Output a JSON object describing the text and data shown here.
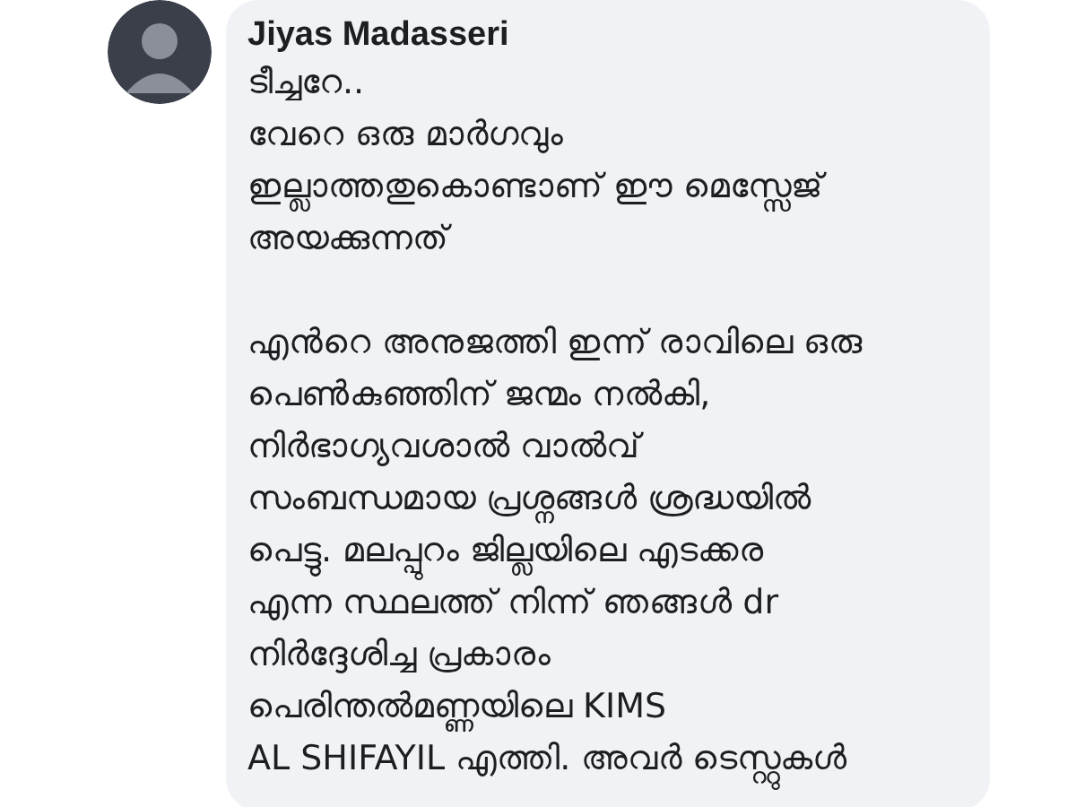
{
  "comment": {
    "author": "Jiyas Madasseri",
    "paragraphs": [
      [
        "ടീച്ചറേ..",
        "വേറെ ഒരു മാർഗവും",
        "ഇല്ലാത്തതുകൊണ്ടാണ് ഈ മെസ്സേജ്",
        "അയക്കുന്നത്"
      ],
      [
        "എൻറെ അനുജത്തി ഇന്ന് രാവിലെ ഒരു",
        "പെൺകുഞ്ഞിന് ജന്മം നൽകി,",
        "നിർഭാഗ്യവശാൽ വാൽവ്",
        "സംബന്ധമായ പ്രശ്നങ്ങൾ ശ്രദ്ധയിൽ",
        "പെട്ടു. മലപ്പുറം ജില്ലയിലെ എടക്കര",
        "എന്ന സ്ഥലത്ത് നിന്ന് ഞങ്ങൾ dr",
        "നിർദ്ദേശിച്ച പ്രകാരം",
        "പെരിന്തൽമണ്ണയിലെ KIMS",
        "AL SHIFAYIL എത്തി. അവർ ടെസ്റ്റുകൾ"
      ]
    ]
  }
}
